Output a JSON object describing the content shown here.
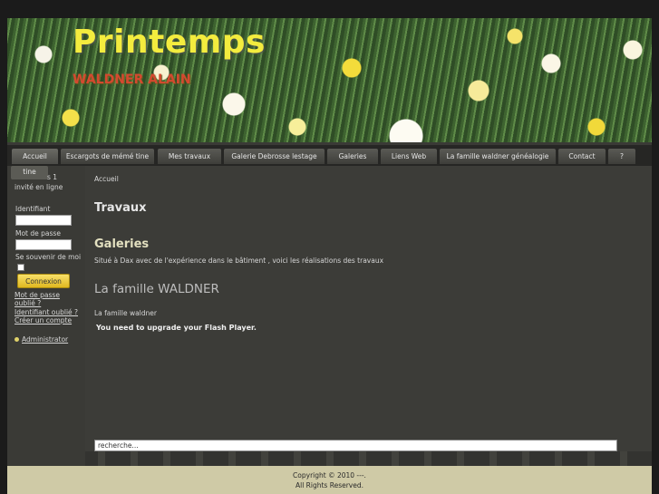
{
  "header": {
    "title": "Printemps",
    "subtitle": "WALDNER ALAIN"
  },
  "nav": {
    "items": [
      {
        "label": "Accueil"
      },
      {
        "label": "Escargots de mémé tine"
      },
      {
        "label": "Mes travaux"
      },
      {
        "label": "Galerie Debrosse lestage"
      },
      {
        "label": "Galeries"
      },
      {
        "label": "Liens Web"
      },
      {
        "label": "La famille waldner généalogie"
      },
      {
        "label": "Contact"
      },
      {
        "label": "?"
      }
    ]
  },
  "sidebar": {
    "tab_label": "tine",
    "online_count": "s 1",
    "online_label": "invité en ligne",
    "username_label": "Identifiant",
    "password_label": "Mot de passe",
    "remember_label": "Se souvenir de moi",
    "login_button": "Connexion",
    "forgot_password": "Mot de passe oublié ?",
    "forgot_username": "Identifiant oublié ?",
    "create_account": "Créer un compte",
    "admin_link": "Administrator"
  },
  "content": {
    "breadcrumb": "Accueil",
    "heading_travaux": "Travaux",
    "heading_galeries": "Galeries",
    "galeries_text": "Situé à Dax  avec de l'expérience dans le bâtiment  , voici les réalisations des travaux",
    "heading_famille": "La famille WALDNER",
    "famille_text": "La famille waldner",
    "flash_message": "You need to upgrade your Flash Player."
  },
  "search": {
    "value": "recherche..."
  },
  "footer": {
    "copyright": "Copyright © 2010 ---.",
    "rights": "All Rights Reserved."
  }
}
